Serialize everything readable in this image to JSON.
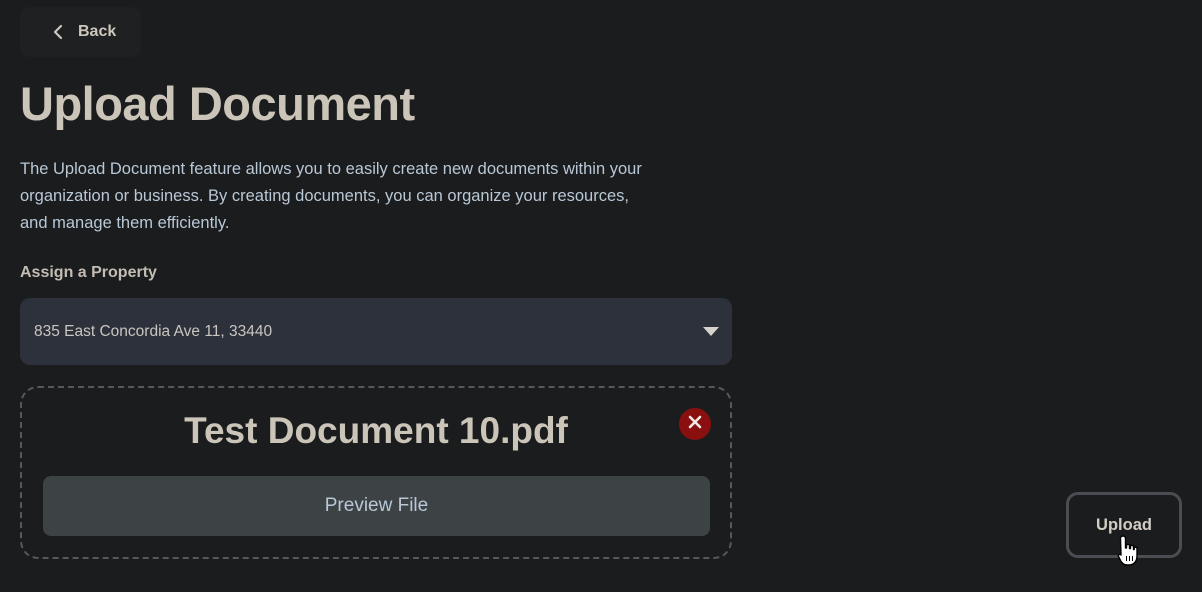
{
  "header": {
    "back_label": "Back",
    "back_icon": "chevron-left-icon"
  },
  "page": {
    "title": "Upload Document",
    "description": "The Upload Document feature allows you to easily create new documents within your organization or business. By creating documents, you can organize your resources, and manage them efficiently."
  },
  "property_field": {
    "label": "Assign a Property",
    "selected_value": "835 East Concordia Ave 11, 33440",
    "caret_icon": "caret-down-icon"
  },
  "file": {
    "name": "Test Document 10.pdf",
    "remove_icon": "close-icon",
    "preview_label": "Preview File"
  },
  "actions": {
    "upload_label": "Upload"
  },
  "colors": {
    "background": "#1b1c1e",
    "title": "#cbc4b9",
    "description": "#b9c8d6",
    "select_bg": "#2d313c",
    "remove_bg": "#8a1010",
    "preview_bg": "#3d4245"
  }
}
